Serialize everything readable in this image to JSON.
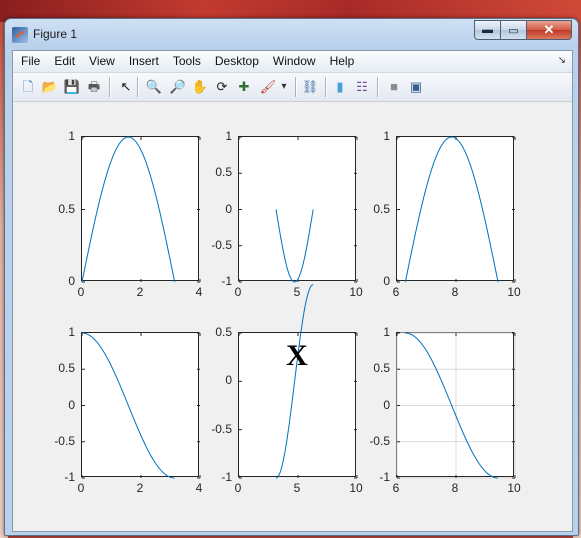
{
  "window": {
    "title": "Figure 1"
  },
  "window_controls": {
    "minimize": "▬",
    "maximize": "▭",
    "close": "✕"
  },
  "menu": [
    "File",
    "Edit",
    "View",
    "Insert",
    "Tools",
    "Desktop",
    "Window",
    "Help"
  ],
  "menu_dock_glyph": "↘",
  "toolbar": [
    {
      "name": "new-figure-icon",
      "glyph": "🗋",
      "color": "#3c76c2"
    },
    {
      "name": "open-file-icon",
      "glyph": "📂",
      "color": "#d4a017"
    },
    {
      "name": "save-icon",
      "glyph": "💾",
      "color": "#2a5bab"
    },
    {
      "name": "print-icon",
      "glyph": "🖶",
      "color": "#555555"
    },
    {
      "name": "edit-plot-icon",
      "glyph": "↖",
      "color": "#111111"
    },
    {
      "name": "zoom-in-icon",
      "glyph": "🔍",
      "color": "#2e62b5"
    },
    {
      "name": "zoom-out-icon",
      "glyph": "🔎",
      "color": "#2e62b5"
    },
    {
      "name": "pan-icon",
      "glyph": "✋",
      "color": "#c08040"
    },
    {
      "name": "rotate-3d-icon",
      "glyph": "⟳",
      "color": "#222222"
    },
    {
      "name": "data-cursor-icon",
      "glyph": "✚",
      "color": "#2f6f2f"
    },
    {
      "name": "brush-icon",
      "glyph": "🖌",
      "color": "#c0392b"
    },
    {
      "name": "brush-dropdown-icon",
      "glyph": "▾",
      "color": "#333333"
    },
    {
      "name": "link-plot-icon",
      "glyph": "⛓",
      "color": "#3a6ea5"
    },
    {
      "name": "insert-colorbar-icon",
      "glyph": "▮",
      "color": "#4aa0d8"
    },
    {
      "name": "insert-legend-icon",
      "glyph": "☷",
      "color": "#7a4a9a"
    },
    {
      "name": "hide-plot-tools-icon",
      "glyph": "■",
      "color": "#8c8c8c"
    },
    {
      "name": "show-plot-tools-icon",
      "glyph": "▣",
      "color": "#3a5f8f"
    }
  ],
  "line_color": "#0072bd",
  "chart_data": [
    {
      "type": "line",
      "function": "sin(x)",
      "x": [
        0,
        0.3927,
        0.7854,
        1.1781,
        1.5708,
        1.9635,
        2.3562,
        2.7489,
        3.1416
      ],
      "y": [
        0,
        0.3827,
        0.7071,
        0.9239,
        1,
        0.9239,
        0.7071,
        0.3827,
        0
      ],
      "xlim": [
        0,
        4
      ],
      "ylim": [
        0,
        1
      ],
      "xticks": [
        "0",
        "2",
        "4"
      ],
      "yticks": [
        "0",
        "0.5",
        "1"
      ],
      "grid": false
    },
    {
      "type": "line",
      "function": "sin(x)",
      "x": [
        3.1416,
        3.5343,
        3.927,
        4.3197,
        4.7124,
        5.1051,
        5.4978,
        5.8905,
        6.2832
      ],
      "y": [
        0,
        -0.3827,
        -0.7071,
        -0.9239,
        -1,
        -0.9239,
        -0.7071,
        -0.3827,
        0
      ],
      "xlim": [
        0,
        10
      ],
      "ylim": [
        -1,
        1
      ],
      "xticks": [
        "0",
        "5",
        "10"
      ],
      "yticks": [
        "-1",
        "-0.5",
        "0",
        "0.5",
        "1"
      ],
      "grid": false
    },
    {
      "type": "line",
      "function": "sin(x)",
      "x": [
        6.2832,
        6.6759,
        7.0686,
        7.4613,
        7.854,
        8.2467,
        8.6394,
        9.0321,
        9.4248
      ],
      "y": [
        0,
        0.3827,
        0.7071,
        0.9239,
        1,
        0.9239,
        0.7071,
        0.3827,
        0
      ],
      "xlim": [
        6,
        10
      ],
      "ylim": [
        0,
        1
      ],
      "xticks": [
        "6",
        "8",
        "10"
      ],
      "yticks": [
        "0",
        "0.5",
        "1"
      ],
      "grid": false
    },
    {
      "type": "line",
      "function": "cos(x)",
      "x": [
        0,
        0.3927,
        0.7854,
        1.1781,
        1.5708,
        1.9635,
        2.3562,
        2.7489,
        3.1416
      ],
      "y": [
        1,
        0.9239,
        0.7071,
        0.3827,
        0,
        -0.3827,
        -0.7071,
        -0.9239,
        -1
      ],
      "xlim": [
        0,
        4
      ],
      "ylim": [
        -1,
        1
      ],
      "xticks": [
        "0",
        "2",
        "4"
      ],
      "yticks": [
        "-1",
        "-0.5",
        "0",
        "0.5",
        "1"
      ],
      "grid": false
    },
    {
      "type": "line",
      "function": "cos(x)",
      "x": [
        3.1416,
        3.5343,
        3.927,
        4.3197,
        4.7124,
        5.1051,
        5.4978,
        5.8905,
        6.2832
      ],
      "y": [
        -1,
        -0.9239,
        -0.7071,
        -0.3827,
        0,
        0.3827,
        0.7071,
        0.9239,
        1
      ],
      "xlim": [
        0,
        10
      ],
      "ylim": [
        -1,
        0.5
      ],
      "xticks": [
        "0",
        "5",
        "10"
      ],
      "yticks": [
        "-1",
        "-0.5",
        "0",
        "0.5"
      ],
      "grid": false,
      "annotation": {
        "text": "X",
        "x": 5,
        "y": 0.25
      }
    },
    {
      "type": "line",
      "function": "cos(x)",
      "x": [
        6.2832,
        6.6759,
        7.0686,
        7.4613,
        7.854,
        8.2467,
        8.6394,
        9.0321,
        9.4248
      ],
      "y": [
        1,
        0.9239,
        0.7071,
        0.3827,
        0,
        -0.3827,
        -0.7071,
        -0.9239,
        -1
      ],
      "xlim": [
        6,
        10
      ],
      "ylim": [
        -1,
        1
      ],
      "xticks": [
        "6",
        "8",
        "10"
      ],
      "yticks": [
        "-1",
        "-0.5",
        "0",
        "0.5",
        "1"
      ],
      "grid": true
    }
  ]
}
